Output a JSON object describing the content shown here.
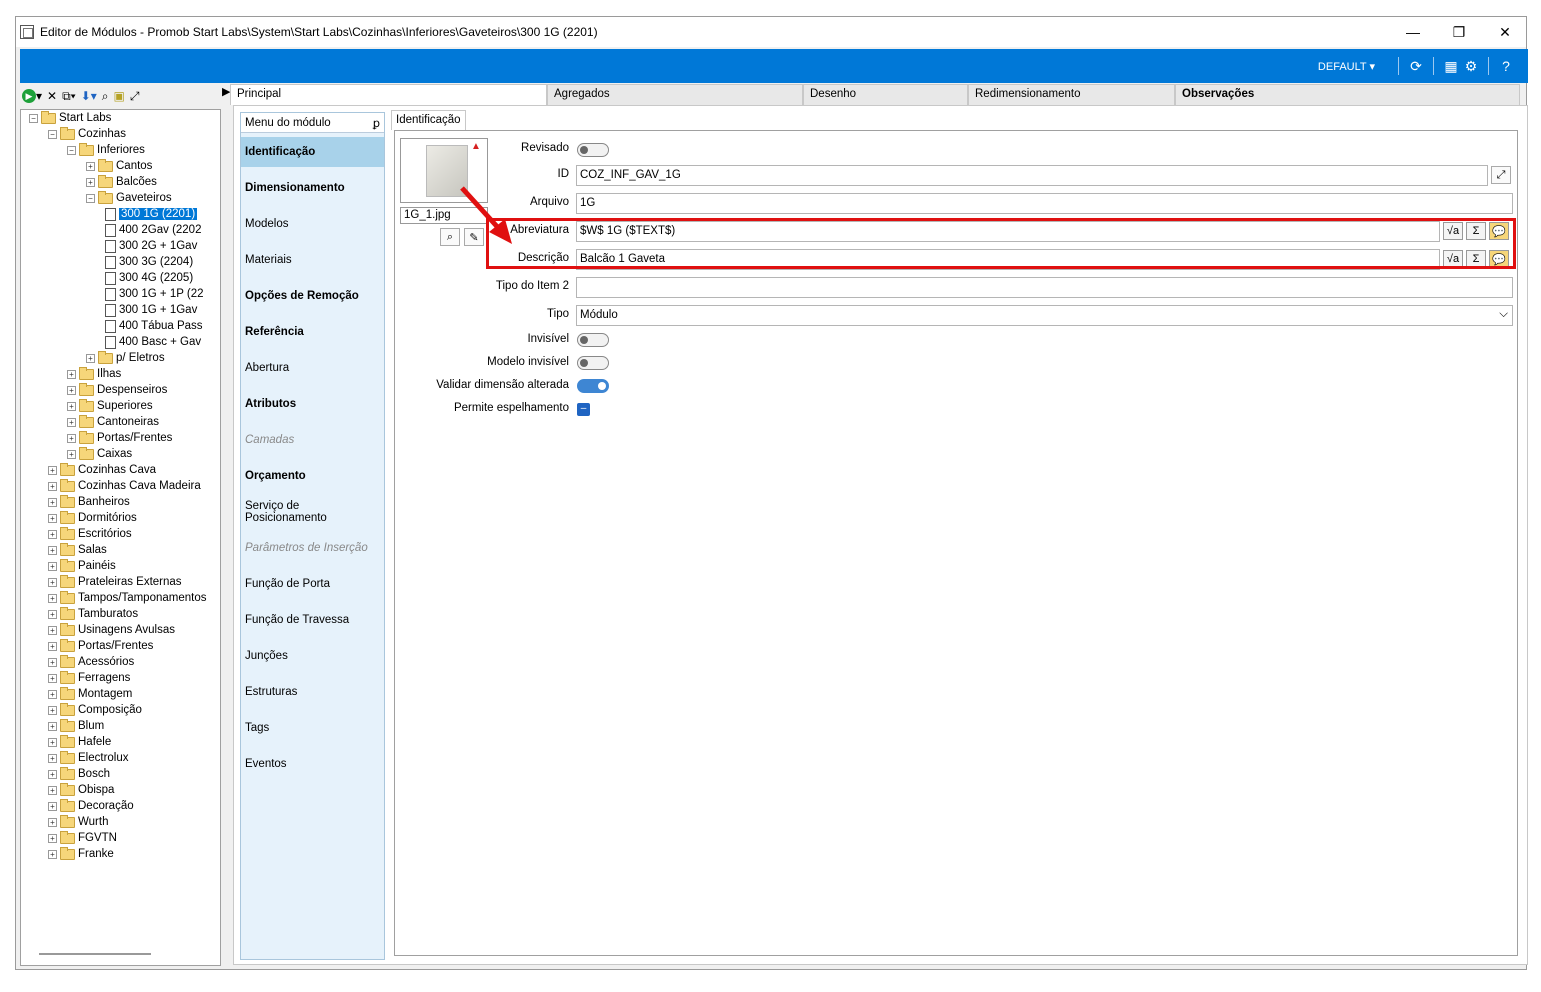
{
  "window": {
    "title": "Editor de Módulos - Promob Start Labs\\System\\Start Labs\\Cozinhas\\Inferiores\\Gaveteiros\\300 1G (2201)",
    "minimize": "—",
    "restore": "❐",
    "close": "✕"
  },
  "topbar": {
    "profile": "DEFAULT ▾"
  },
  "tree": {
    "nodes": [
      {
        "label": "Start Labs",
        "exp": "−"
      },
      {
        "label": "Cozinhas",
        "exp": "−"
      },
      {
        "label": "Inferiores",
        "exp": "−"
      },
      {
        "label": "Cantos",
        "exp": "+"
      },
      {
        "label": "Balcões",
        "exp": "+"
      },
      {
        "label": "Gaveteiros",
        "exp": "−"
      },
      {
        "label": "300 1G (2201)"
      },
      {
        "label": "400 2Gav (2202"
      },
      {
        "label": "300 2G + 1Gav"
      },
      {
        "label": "300 3G (2204)"
      },
      {
        "label": "300 4G (2205)"
      },
      {
        "label": "300 1G + 1P (22"
      },
      {
        "label": "300 1G + 1Gav"
      },
      {
        "label": "400 Tábua Pass"
      },
      {
        "label": "400 Basc + Gav"
      },
      {
        "label": "p/ Eletros",
        "exp": "+"
      },
      {
        "label": "Ilhas",
        "exp": "+"
      },
      {
        "label": "Despenseiros",
        "exp": "+"
      },
      {
        "label": "Superiores",
        "exp": "+"
      },
      {
        "label": "Cantoneiras",
        "exp": "+"
      },
      {
        "label": "Portas/Frentes",
        "exp": "+"
      },
      {
        "label": "Caixas",
        "exp": "+"
      },
      {
        "label": "Cozinhas Cava",
        "exp": "+"
      },
      {
        "label": "Cozinhas Cava Madeira",
        "exp": "+"
      },
      {
        "label": "Banheiros",
        "exp": "+"
      },
      {
        "label": "Dormitórios",
        "exp": "+"
      },
      {
        "label": "Escritórios",
        "exp": "+"
      },
      {
        "label": "Salas",
        "exp": "+"
      },
      {
        "label": "Painéis",
        "exp": "+"
      },
      {
        "label": "Prateleiras Externas",
        "exp": "+"
      },
      {
        "label": "Tampos/Tamponamentos",
        "exp": "+"
      },
      {
        "label": "Tamburatos",
        "exp": "+"
      },
      {
        "label": "Usinagens Avulsas",
        "exp": "+"
      },
      {
        "label": "Portas/Frentes",
        "exp": "+"
      },
      {
        "label": "Acessórios",
        "exp": "+"
      },
      {
        "label": "Ferragens",
        "exp": "+"
      },
      {
        "label": "Montagem",
        "exp": "+"
      },
      {
        "label": "Composição",
        "exp": "+"
      },
      {
        "label": "Blum",
        "exp": "+"
      },
      {
        "label": "Hafele",
        "exp": "+"
      },
      {
        "label": "Electrolux",
        "exp": "+"
      },
      {
        "label": "Bosch",
        "exp": "+"
      },
      {
        "label": "Obispa",
        "exp": "+"
      },
      {
        "label": "Decoração",
        "exp": "+"
      },
      {
        "label": "Wurth",
        "exp": "+"
      },
      {
        "label": "FGVTN",
        "exp": "+"
      },
      {
        "label": "Franke",
        "exp": "+"
      }
    ]
  },
  "tabs": [
    {
      "label": "Principal"
    },
    {
      "label": "Agregados"
    },
    {
      "label": "Desenho"
    },
    {
      "label": "Redimensionamento"
    },
    {
      "label": "Observações"
    }
  ],
  "module_menu": {
    "header": "Menu do módulo",
    "pin": "ꝑ",
    "items": [
      {
        "label": "Identificação"
      },
      {
        "label": "Dimensionamento"
      },
      {
        "label": "Modelos"
      },
      {
        "label": "Materiais"
      },
      {
        "label": "Opções de Remoção"
      },
      {
        "label": "Referência"
      },
      {
        "label": "Abertura"
      },
      {
        "label": "Atributos"
      },
      {
        "label": "Camadas"
      },
      {
        "label": "Orçamento"
      },
      {
        "label": "Serviço de Posicionamento"
      },
      {
        "label": "Parâmetros de Inserção"
      },
      {
        "label": "Função de Porta"
      },
      {
        "label": "Função de Travessa"
      },
      {
        "label": "Junções"
      },
      {
        "label": "Estruturas"
      },
      {
        "label": "Tags"
      },
      {
        "label": "Eventos"
      }
    ]
  },
  "identification": {
    "tab": "Identificação",
    "image_file": "1G_1.jpg",
    "fields": {
      "revisado": {
        "label": "Revisado"
      },
      "id": {
        "label": "ID",
        "value": "COZ_INF_GAV_1G"
      },
      "arquivo": {
        "label": "Arquivo",
        "value": "1G"
      },
      "abreviatura": {
        "label": "Abreviatura",
        "value": "$W$ 1G ($TEXT$)"
      },
      "descricao": {
        "label": "Descrição",
        "value": "Balcão 1 Gaveta"
      },
      "tipo_item2": {
        "label": "Tipo do Item 2",
        "value": ""
      },
      "tipo": {
        "label": "Tipo",
        "value": "Módulo"
      },
      "invisivel": {
        "label": "Invisível"
      },
      "modelo_invisivel": {
        "label": "Modelo invisível"
      },
      "validar": {
        "label": "Validar dimensão alterada"
      },
      "espelhamento": {
        "label": "Permite espelhamento"
      }
    },
    "fx_labels": {
      "formula": "√a",
      "sum": "Σ",
      "comment": "💬"
    },
    "dropdown_arrow": "⌵"
  },
  "colors": {
    "title_blue": "#0078d7",
    "highlight_red": "#e01010",
    "menu_bg": "#e6f2fb",
    "menu_active": "#a8d2ea",
    "toggle_on": "#3e86d3"
  }
}
